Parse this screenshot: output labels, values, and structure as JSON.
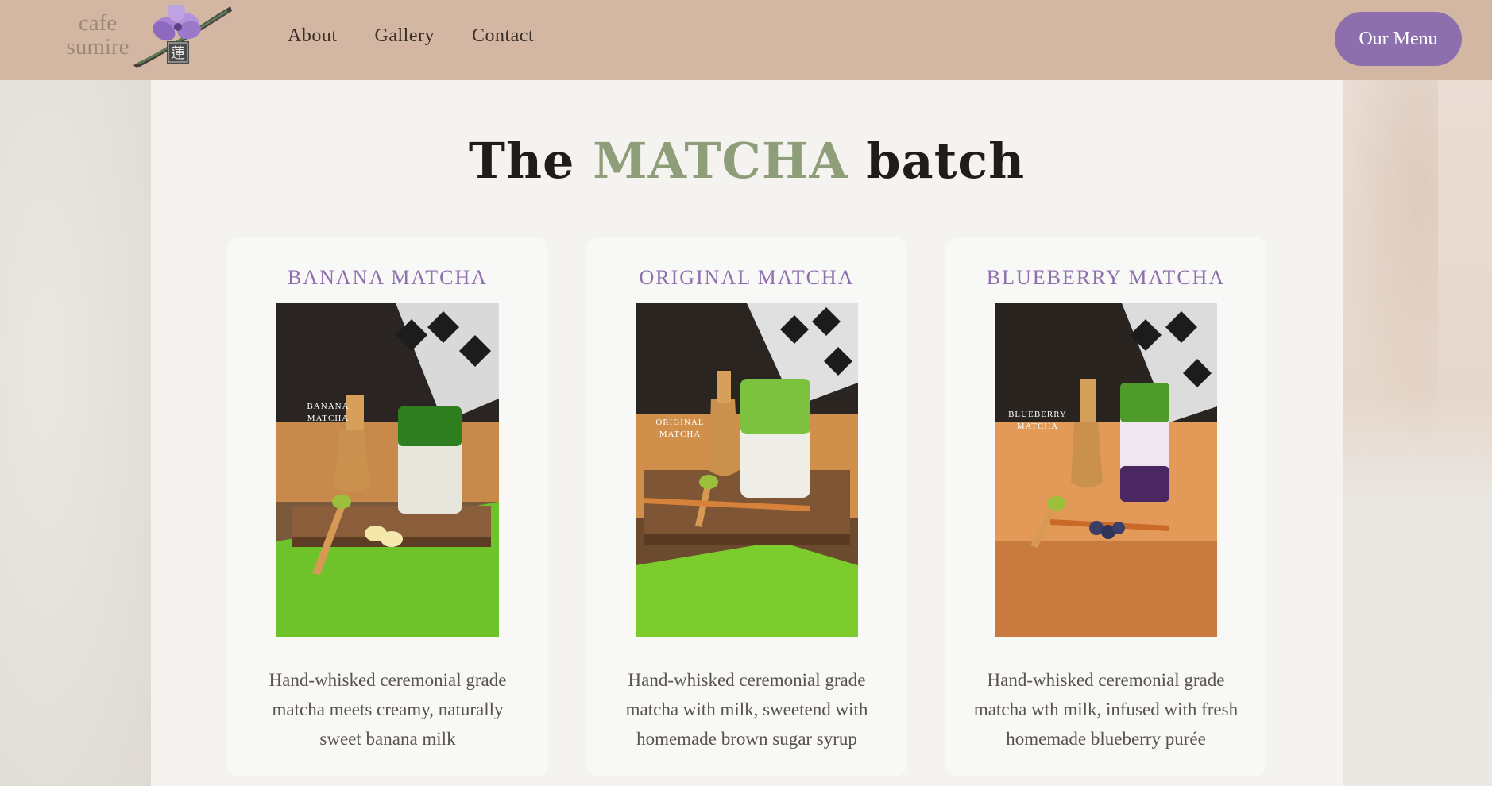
{
  "brand": {
    "line1": "cafe",
    "line2": "sumire",
    "kanji": "蓮",
    "flower_color": "#9b78c9"
  },
  "nav": {
    "items": [
      {
        "label": "About"
      },
      {
        "label": "Gallery"
      },
      {
        "label": "Contact"
      }
    ],
    "cta_label": "Our Menu"
  },
  "colors": {
    "header_bg": "#d3b7a3",
    "accent_purple": "#8e6fae",
    "accent_green": "#8e9e78"
  },
  "heading": {
    "prefix": "The",
    "highlight": "MATCHA",
    "suffix": "batch"
  },
  "cards": [
    {
      "title": "BANANA MATCHA",
      "image_label_1": "BANANA",
      "image_label_2": "MATCHA",
      "description": "Hand-whisked ceremonial grade matcha meets creamy, naturally sweet banana milk"
    },
    {
      "title": "ORIGINAL MATCHA",
      "image_label_1": "ORIGINAL",
      "image_label_2": "MATCHA",
      "description": "Hand-whisked ceremonial grade matcha with milk, sweetend with homemade brown sugar syrup"
    },
    {
      "title": "BLUEBERRY MATCHA",
      "image_label_1": "BLUEBERRY",
      "image_label_2": "MATCHA",
      "description": "Hand-whisked ceremonial grade matcha wth milk, infused with fresh homemade blueberry purée"
    }
  ]
}
